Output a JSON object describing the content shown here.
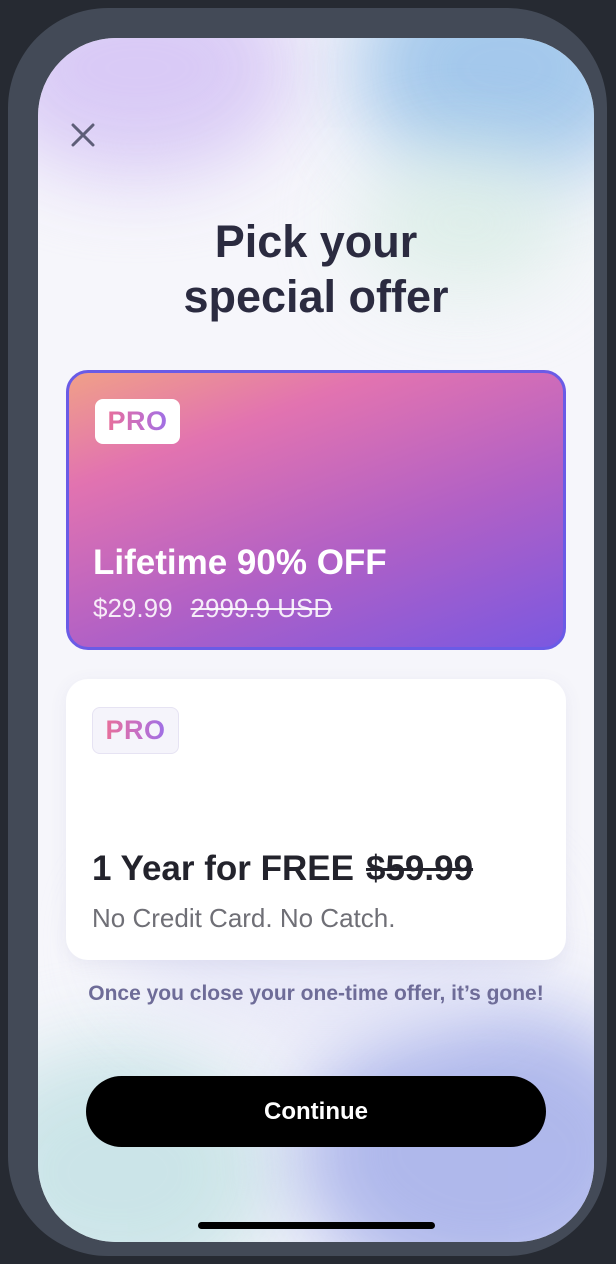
{
  "header": {
    "close_icon": "close-icon",
    "title_line1": "Pick your",
    "title_line2": "special offer"
  },
  "offers": [
    {
      "badge": "PRO",
      "title": "Lifetime 90% OFF",
      "price": "$29.99",
      "original_price": "2999.9 USD",
      "selected": true
    },
    {
      "badge": "PRO",
      "title": "1 Year for FREE",
      "original_price": "$59.99",
      "subtitle": "No Credit Card. No Catch.",
      "selected": false
    }
  ],
  "notice": "Once you close your one-time offer, it’s gone!",
  "continue_label": "Continue",
  "colors": {
    "title": "#2b2b40",
    "selected_border": "#6a5be6",
    "button": "#000000",
    "notice": "#6e6c98"
  }
}
